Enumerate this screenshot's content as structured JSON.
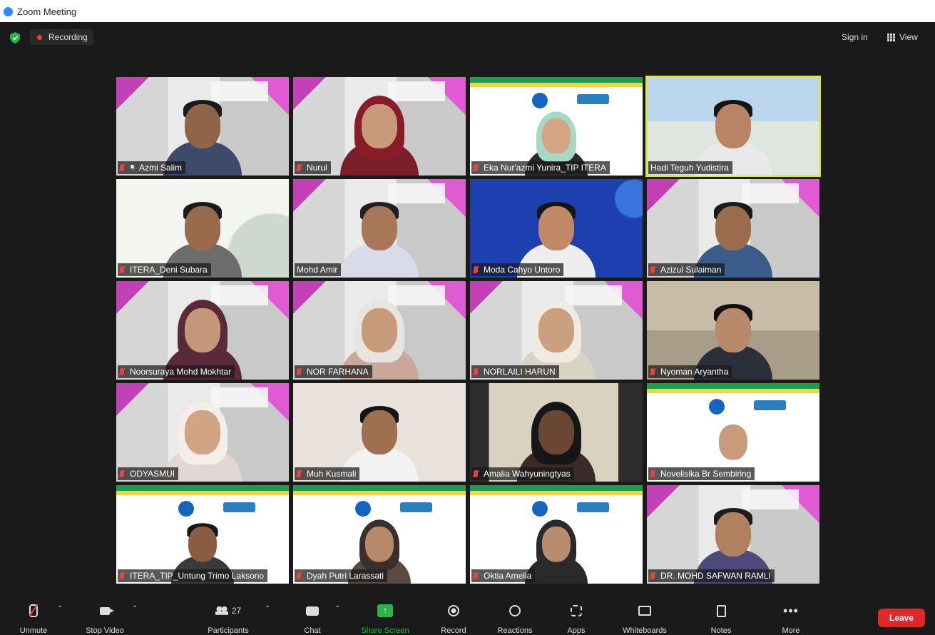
{
  "window": {
    "title": "Zoom Meeting"
  },
  "topbar": {
    "recording_label": "Recording",
    "sign_in": "Sign in",
    "view": "View"
  },
  "participants": [
    {
      "name": "Azmi Salim",
      "muted": true,
      "pinned": true,
      "bg": "banner"
    },
    {
      "name": "Nurul",
      "muted": true,
      "pinned": false,
      "bg": "banner"
    },
    {
      "name": "Eka Nur'azmi Yunira_TIP ITERA",
      "muted": true,
      "pinned": false,
      "bg": "itera"
    },
    {
      "name": "Hadi Teguh Yudistira",
      "muted": false,
      "pinned": false,
      "bg": "campus",
      "active_speaker": true
    },
    {
      "name": "ITERA_Deni Subara",
      "muted": true,
      "pinned": false,
      "bg": "leaf"
    },
    {
      "name": "Mohd Amir",
      "muted": false,
      "pinned": false,
      "bg": "banner"
    },
    {
      "name": "Moda Cahyo Untoro",
      "muted": true,
      "pinned": false,
      "bg": "blue"
    },
    {
      "name": "Azizul Sulaiman",
      "muted": true,
      "pinned": false,
      "bg": "banner"
    },
    {
      "name": "Noorsuraya Mohd Mokhtar",
      "muted": true,
      "pinned": false,
      "bg": "banner"
    },
    {
      "name": "NOR FARHANA",
      "muted": true,
      "pinned": false,
      "bg": "banner"
    },
    {
      "name": "NORLAILI HARUN",
      "muted": true,
      "pinned": false,
      "bg": "banner"
    },
    {
      "name": "Nyoman Aryantha",
      "muted": true,
      "pinned": false,
      "bg": "room"
    },
    {
      "name": "ODYASMUI",
      "muted": true,
      "pinned": false,
      "bg": "banner"
    },
    {
      "name": "Muh Kusmali",
      "muted": true,
      "pinned": false,
      "bg": "plain"
    },
    {
      "name": "Amalia Wahyuningtyas",
      "muted": true,
      "pinned": false,
      "bg": "darkcampus"
    },
    {
      "name": "Novelisika Br Sembiring",
      "muted": true,
      "pinned": false,
      "bg": "itera"
    },
    {
      "name": "ITERA_TIP_Untung Trimo Laksono",
      "muted": true,
      "pinned": false,
      "bg": "itera"
    },
    {
      "name": "Dyah Putri Larassati",
      "muted": true,
      "pinned": false,
      "bg": "itera"
    },
    {
      "name": "Oktia Amelia",
      "muted": true,
      "pinned": false,
      "bg": "itera"
    },
    {
      "name": "DR. MOHD SAFWAN RAMLI",
      "muted": true,
      "pinned": false,
      "bg": "banner"
    }
  ],
  "toolbar": {
    "unmute": "Unmute",
    "stop_video": "Stop Video",
    "participants": "Participants",
    "participants_count": "27",
    "chat": "Chat",
    "share_screen": "Share Screen",
    "record": "Record",
    "reactions": "Reactions",
    "apps": "Apps",
    "whiteboards": "Whiteboards",
    "notes": "Notes",
    "more": "More",
    "leave": "Leave"
  },
  "colors": {
    "accent_green": "#2eb34a",
    "leave_red": "#e02828",
    "recording_red": "#e0463f",
    "active_speaker": "#d9e44f"
  }
}
